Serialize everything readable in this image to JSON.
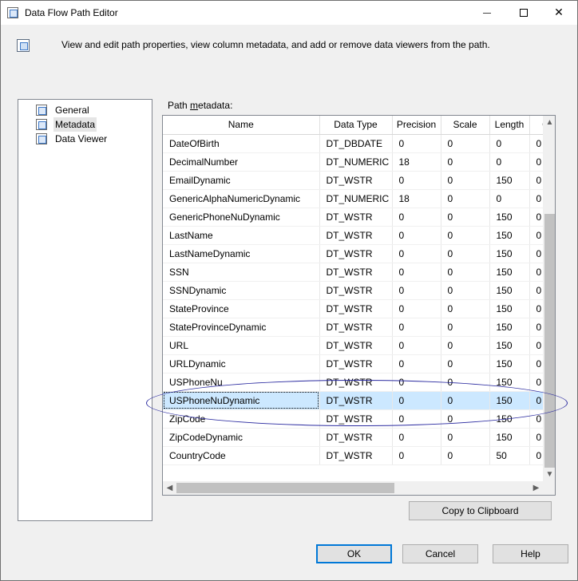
{
  "window": {
    "title": "Data Flow Path Editor",
    "minimize_label": "minimize",
    "maximize_label": "maximize",
    "close_glyph": "✕"
  },
  "header": {
    "description": "View and edit path properties, view column metadata, and add or remove data viewers from the path."
  },
  "nav": {
    "items": [
      {
        "label": "General",
        "icon": "page-icon",
        "selected": false
      },
      {
        "label": "Metadata",
        "icon": "page-icon",
        "selected": true
      },
      {
        "label": "Data Viewer",
        "icon": "page-icon",
        "selected": false
      }
    ]
  },
  "metadata": {
    "label_prefix": "Path ",
    "label_underlined": "m",
    "label_suffix": "etadata:",
    "columns": [
      "Name",
      "Data Type",
      "Precision",
      "Scale",
      "Length",
      "C"
    ],
    "rows": [
      [
        "DateOfBirth",
        "DT_DBDATE",
        "0",
        "0",
        "0",
        "0"
      ],
      [
        "DecimalNumber",
        "DT_NUMERIC",
        "18",
        "0",
        "0",
        "0"
      ],
      [
        "EmailDynamic",
        "DT_WSTR",
        "0",
        "0",
        "150",
        "0"
      ],
      [
        "GenericAlphaNumericDynamic",
        "DT_NUMERIC",
        "18",
        "0",
        "0",
        "0"
      ],
      [
        "GenericPhoneNuDynamic",
        "DT_WSTR",
        "0",
        "0",
        "150",
        "0"
      ],
      [
        "LastName",
        "DT_WSTR",
        "0",
        "0",
        "150",
        "0"
      ],
      [
        "LastNameDynamic",
        "DT_WSTR",
        "0",
        "0",
        "150",
        "0"
      ],
      [
        "SSN",
        "DT_WSTR",
        "0",
        "0",
        "150",
        "0"
      ],
      [
        "SSNDynamic",
        "DT_WSTR",
        "0",
        "0",
        "150",
        "0"
      ],
      [
        "StateProvince",
        "DT_WSTR",
        "0",
        "0",
        "150",
        "0"
      ],
      [
        "StateProvinceDynamic",
        "DT_WSTR",
        "0",
        "0",
        "150",
        "0"
      ],
      [
        "URL",
        "DT_WSTR",
        "0",
        "0",
        "150",
        "0"
      ],
      [
        "URLDynamic",
        "DT_WSTR",
        "0",
        "0",
        "150",
        "0"
      ],
      [
        "USPhoneNu",
        "DT_WSTR",
        "0",
        "0",
        "150",
        "0"
      ],
      [
        "USPhoneNuDynamic",
        "DT_WSTR",
        "0",
        "0",
        "150",
        "0"
      ],
      [
        "ZipCode",
        "DT_WSTR",
        "0",
        "0",
        "150",
        "0"
      ],
      [
        "ZipCodeDynamic",
        "DT_WSTR",
        "0",
        "0",
        "150",
        "0"
      ],
      [
        "CountryCode",
        "DT_WSTR",
        "0",
        "0",
        "50",
        "0"
      ]
    ],
    "selected_row": 14
  },
  "buttons": {
    "copy_label": "Copy to Clipboard",
    "ok_label": "OK",
    "cancel_label": "Cancel",
    "help_label": "Help"
  },
  "colors": {
    "selection": "#cce8ff",
    "highlight_ellipse": "#2b2ba0",
    "ok_border": "#0078d7"
  }
}
